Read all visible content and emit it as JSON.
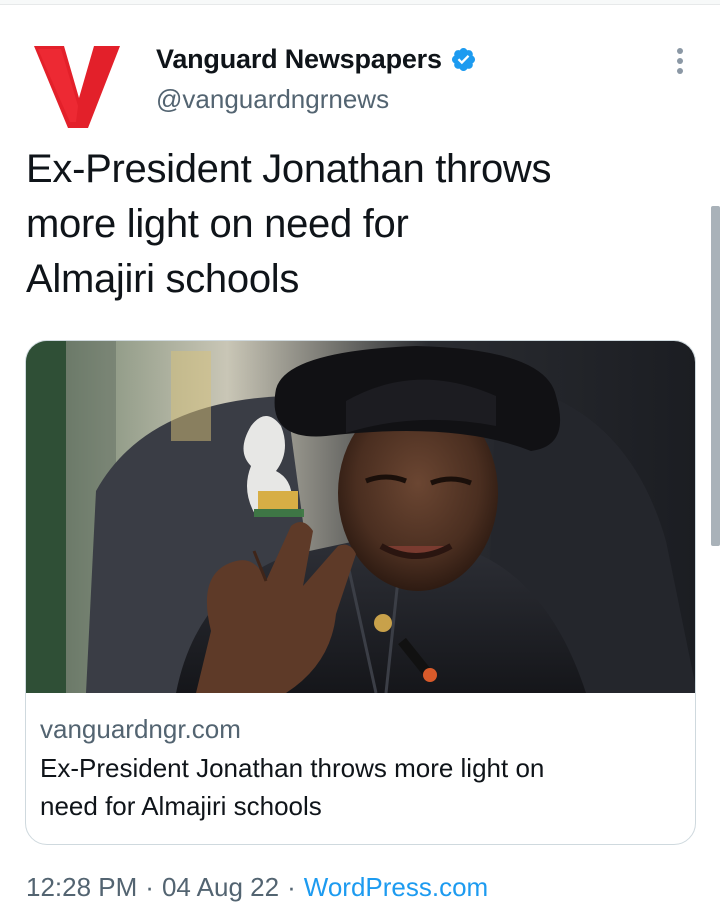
{
  "tweet": {
    "author": {
      "name": "Vanguard Newspapers",
      "handle": "@vanguardngrnews",
      "verified": true,
      "avatar_letter": "V",
      "avatar_color": "#e3202a"
    },
    "text_lines": [
      "Ex-President Jonathan throws",
      "more light on need for",
      "Almajiri schools"
    ],
    "card": {
      "domain": "vanguardngr.com",
      "title_lines": [
        "Ex-President Jonathan throws more light on",
        "need for Almajiri schools"
      ]
    },
    "time": "12:28 PM",
    "date": "04 Aug 22",
    "separator": "·",
    "source": "WordPress.com"
  },
  "icons": {
    "verified": "verified-badge-icon",
    "more": "more-vertical-icon"
  },
  "colors": {
    "accent": "#1d9bf0",
    "secondary_text": "#536471",
    "brand_red": "#e3202a"
  }
}
